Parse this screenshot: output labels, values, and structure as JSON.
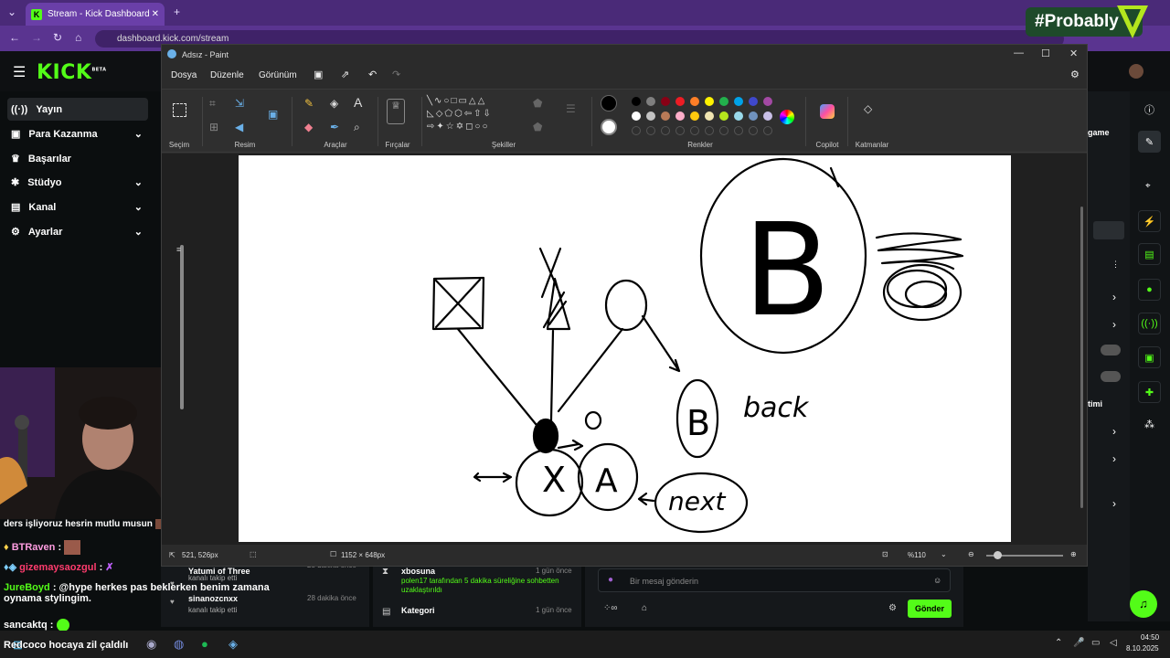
{
  "browser": {
    "tab_title": "Stream - Kick Dashboard",
    "url": "dashboard.kick.com/stream",
    "overlay_text": "#Probably"
  },
  "kick": {
    "logo": "KICK",
    "logo_badge": "BETA",
    "nav": [
      {
        "label": "Yayın",
        "icon": "((·))",
        "chevron": false,
        "active": true
      },
      {
        "label": "Para Kazanma",
        "icon": "▣",
        "chevron": true,
        "active": false
      },
      {
        "label": "Başarılar",
        "icon": "🏆",
        "chevron": false,
        "active": false
      },
      {
        "label": "Stüdyo",
        "icon": "✱",
        "chevron": true,
        "active": false
      },
      {
        "label": "Kanal",
        "icon": "▤",
        "chevron": true,
        "active": false
      },
      {
        "label": "Ayarlar",
        "icon": "⚙",
        "chevron": true,
        "active": false
      }
    ],
    "right_panel_fragments": [
      "game",
      "timi"
    ],
    "chat": [
      {
        "user": "",
        "text": "ders işliyoruz hesrin mutlu musun",
        "color": "#ffffff"
      },
      {
        "user": "BTRaven",
        "text": ":",
        "color": "#ff9de1"
      },
      {
        "user": "gizemaysaozgul",
        "text": ":",
        "color": "#ff3c6e"
      },
      {
        "user": "JureBoyd",
        "text": ": @hype herkes pas beklerken benim zamana oynama stylingim.",
        "color": "#53fc18"
      },
      {
        "user": "sancaktq",
        "text": ":",
        "color": "#ffffff"
      },
      {
        "user": "Redcoco",
        "text": "hocaya zil çaldılı",
        "color": "#ffffff"
      }
    ],
    "activity": [
      {
        "user": "Yatumi of Three",
        "action": "kanalı takip etti",
        "time": "28 dakika önce"
      },
      {
        "user": "sinanozcnxx",
        "action": "kanalı takip etti",
        "time": "28 dakika önce"
      }
    ],
    "events": [
      {
        "user": "xbosuna",
        "time": "1 gün önce",
        "detail": "polen17 tarafından 5 dakika süreliğine sohbetten uzaklaştırıldı"
      },
      {
        "user": "Kategori",
        "time": "1 gün önce",
        "detail": ""
      }
    ],
    "message_placeholder": "Bir mesaj gönderin",
    "send_label": "Gönder"
  },
  "paint": {
    "window_title": "Adsız - Paint",
    "menu": [
      "Dosya",
      "Düzenle",
      "Görünüm"
    ],
    "groups": [
      "Seçim",
      "Resim",
      "Araçlar",
      "Fırçalar",
      "Şekiller",
      "Renkler",
      "Copilot",
      "Katmanlar"
    ],
    "palette": [
      "#000000",
      "#7f7f7f",
      "#880015",
      "#ed1c24",
      "#ff7f27",
      "#fff200",
      "#22b14c",
      "#00a2e8",
      "#3f48cc",
      "#a349a4",
      "#ffffff",
      "#c3c3c3",
      "#b97a57",
      "#ffaec9",
      "#ffc90e",
      "#efe4b0",
      "#b5e61d",
      "#99d9ea",
      "#7092be",
      "#c8bfe7"
    ],
    "cursor_pos": "521, 526px",
    "canvas_size": "1152 × 648px",
    "zoom": "%110",
    "canvas_text": {
      "back": "back",
      "next": "next",
      "node_a": "A",
      "node_b_small": "B",
      "node_b_big": "B",
      "node_x": "X",
      "node_o": "o"
    }
  },
  "taskbar": {
    "time": "04:50",
    "date": "8.10.2025"
  }
}
